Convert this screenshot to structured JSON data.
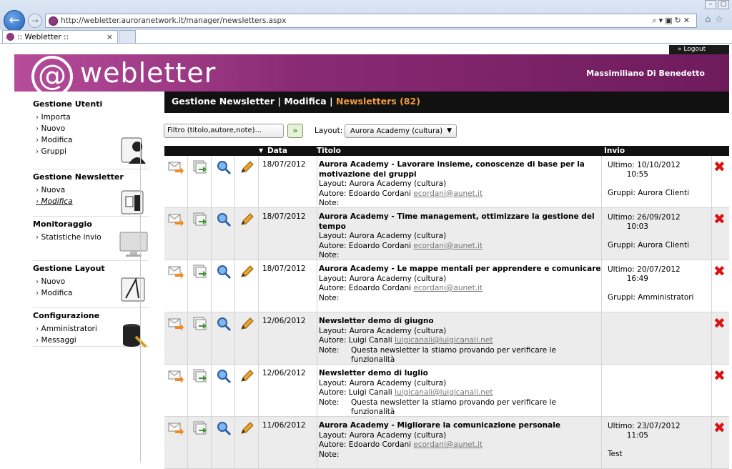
{
  "browser": {
    "url": "http://webletter.auroranetwork.it/manager/newsletters.aspx",
    "tab_title": ":: Webletter ::",
    "tab_close": "×"
  },
  "header": {
    "logout": "» Logout",
    "logo_text": "webletter",
    "user": "Massimiliano Di Benedetto"
  },
  "sidebar": {
    "sections": [
      {
        "title": "Gestione Utenti",
        "items": [
          "Importa",
          "Nuovo",
          "Modifica",
          "Gruppi"
        ]
      },
      {
        "title": "Gestione Newsletter",
        "items": [
          "Nuova",
          "Modifica"
        ]
      },
      {
        "title": "Monitoraggio",
        "items": [
          "Statistiche invio"
        ]
      },
      {
        "title": "Gestione Layout",
        "items": [
          "Nuovo",
          "Modifica"
        ]
      },
      {
        "title": "Configurazione",
        "items": [
          "Amministratori",
          "Messaggi"
        ]
      }
    ]
  },
  "content": {
    "crumb1": "Gestione Newsletter",
    "sep": "|",
    "crumb2": "Modifica",
    "crumb3": "Newsletters (82)",
    "filter_placeholder": "Filtro (titolo,autore,note)...",
    "go": "»",
    "layout_label": "Layout:",
    "layout_value": "Aurora Academy (cultura)",
    "columns": {
      "data": "Data",
      "titolo": "Titolo",
      "invio": "Invio"
    }
  },
  "rows": [
    {
      "date": "18/07/2012",
      "title": "Aurora Academy - Lavorare insieme, conoscenze di base per la motivazione dei gruppi",
      "layout": "Layout: Aurora Academy (cultura)",
      "author": "Autore: Edoardo Cordani",
      "email": "ecordani@aunet.it",
      "note_label": "Note:",
      "note": "",
      "invio": "Ultimo: 10/10/2012\n        10:55\n\nGruppi: Aurora Clienti"
    },
    {
      "date": "18/07/2012",
      "title": "Aurora Academy - Time management, ottimizzare la gestione del tempo",
      "layout": "Layout: Aurora Academy (cultura)",
      "author": "Autore: Edoardo Cordani",
      "email": "ecordani@aunet.it",
      "note_label": "Note:",
      "note": "",
      "invio": "Ultimo: 26/09/2012\n        10:03\n\nGruppi: Aurora Clienti"
    },
    {
      "date": "18/07/2012",
      "title": "Aurora Academy - Le mappe mentali per apprendere e comunicare",
      "layout": "Layout: Aurora Academy (cultura)",
      "author": "Autore: Edoardo Cordani",
      "email": "ecordani@aunet.it",
      "note_label": "Note:",
      "note": "",
      "invio": "Ultimo: 20/07/2012\n        16:49\n\nGruppi: Amministratori"
    },
    {
      "date": "12/06/2012",
      "title": "Newsletter demo di giugno",
      "layout": "Layout: Aurora Academy (cultura)",
      "author": "Autore: Luigi Canali",
      "email": "luigicanali@luigicanali.net",
      "note_label": "Note:",
      "note": "Questa newsletter la stiamo provando per verificare le funzionalità",
      "invio": ""
    },
    {
      "date": "12/06/2012",
      "title": "Newsletter demo di luglio",
      "layout": "Layout: Aurora Academy (cultura)",
      "author": "Autore: Luigi Canali",
      "email": "luigicanali@luigicanali.net",
      "note_label": "Note:",
      "note": "Questa newsletter la stiamo provando per verificare le funzionalità",
      "invio": ""
    },
    {
      "date": "11/06/2012",
      "title": "Aurora Academy - Migliorare la comunicazione personale",
      "layout": "Layout: Aurora Academy (cultura)",
      "author": "Autore: Edoardo Cordani",
      "email": "ecordani@aunet.it",
      "note_label": "Note:",
      "note": "",
      "invio": "Ultimo: 23/07/2012\n        11:05\n\nTest"
    }
  ]
}
